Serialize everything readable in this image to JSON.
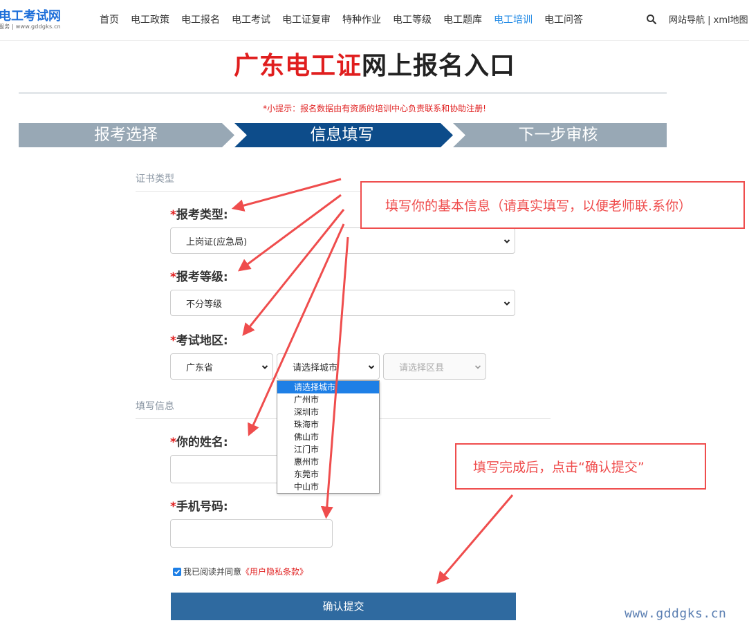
{
  "header": {
    "logo_title": "电工考试网",
    "logo_subtitle": "服务 | www.gddgks.cn",
    "nav": [
      "首页",
      "电工政策",
      "电工报名",
      "电工考试",
      "电工证复审",
      "特种作业",
      "电工等级",
      "电工题库",
      "电工培训",
      "电工问答"
    ],
    "active_nav": "电工培训",
    "site_nav": "网站导航 | xml地图"
  },
  "title": {
    "part_red": "广东电工证",
    "part_black": "网上报名入口"
  },
  "tip": "*小提示：报名数据由有资质的培训中心负责联系和协助注册!",
  "steps": [
    "报考选择",
    "信息填写",
    "下一步审核"
  ],
  "colors": {
    "step_inactive": "#98a8b5",
    "step_active": "#0d4c8a",
    "accent_red": "#e01e1e",
    "submit": "#2f6aa0",
    "annotation": "#ef4d4d"
  },
  "form": {
    "section_cert": "证书类型",
    "exam_type_label": "报考类型:",
    "exam_type_value": "上岗证(应急局)",
    "exam_level_label": "报考等级:",
    "exam_level_value": "不分等级",
    "region_label": "考试地区:",
    "province_value": "广东省",
    "city_value": "请选择城市",
    "district_value": "请选择区县",
    "city_options": [
      "请选择城市",
      "广州市",
      "深圳市",
      "珠海市",
      "佛山市",
      "江门市",
      "惠州市",
      "东莞市",
      "中山市"
    ],
    "section_info": "填写信息",
    "name_label": "你的姓名:",
    "name_value": "",
    "phone_label": "手机号码:",
    "phone_value": "",
    "required_mark": "*",
    "agree_text": "我已阅读并同意",
    "agree_link": "《用户隐私条款》",
    "submit_label": "确认提交"
  },
  "annotations": {
    "callout_info": "填写你的基本信息（请真实填写，以便老师联.系你）",
    "callout_submit": "填写完成后，点击“确认提交”",
    "watermark": "www.gddgks.cn"
  }
}
